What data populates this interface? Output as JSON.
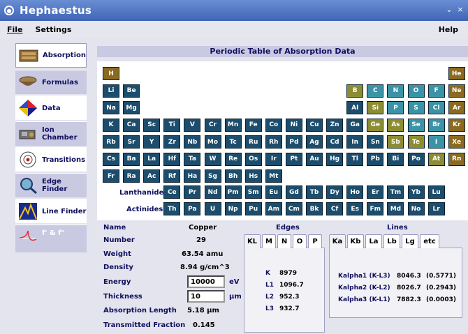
{
  "window": {
    "title": "Hephaestus",
    "controls": [
      "⌄",
      "×"
    ]
  },
  "menu": {
    "file": "File",
    "settings": "Settings",
    "help": "Help"
  },
  "sidebar": {
    "items": [
      {
        "label": "Absorption",
        "icon": "absorption-icon"
      },
      {
        "label": "Formulas",
        "icon": "formulas-icon"
      },
      {
        "label": "Data",
        "icon": "data-icon"
      },
      {
        "label": "Ion Chamber",
        "icon": "ion-chamber-icon"
      },
      {
        "label": "Transitions",
        "icon": "transitions-icon"
      },
      {
        "label": "Edge Finder",
        "icon": "edge-finder-icon"
      },
      {
        "label": "Line Finder",
        "icon": "line-finder-icon"
      },
      {
        "label": "f' & f\"",
        "icon": "anomalous-scattering-icon"
      }
    ],
    "active": 0
  },
  "periodic_table": {
    "title": "Periodic Table of Absorption Data",
    "lanthanides_label": "Lanthanides",
    "actinides_label": "Actinides",
    "colors": {
      "blue": "#1d4d6c",
      "teal": "#3a93a6",
      "olive": "#8c8c32",
      "brown": "#8b6a1f"
    },
    "rows": [
      [
        [
          "H",
          "brown",
          0
        ],
        [
          "He",
          "brown",
          17
        ]
      ],
      [
        [
          "Li",
          "blue",
          0
        ],
        [
          "Be",
          "blue",
          1
        ],
        [
          "B",
          "olive",
          12
        ],
        [
          "C",
          "teal",
          13
        ],
        [
          "N",
          "teal",
          14
        ],
        [
          "O",
          "teal",
          15
        ],
        [
          "F",
          "teal",
          16
        ],
        [
          "Ne",
          "brown",
          17
        ]
      ],
      [
        [
          "Na",
          "blue",
          0
        ],
        [
          "Mg",
          "blue",
          1
        ],
        [
          "Al",
          "blue",
          12
        ],
        [
          "Si",
          "olive",
          13
        ],
        [
          "P",
          "teal",
          14
        ],
        [
          "S",
          "teal",
          15
        ],
        [
          "Cl",
          "teal",
          16
        ],
        [
          "Ar",
          "brown",
          17
        ]
      ],
      [
        [
          "K",
          "blue",
          0
        ],
        [
          "Ca",
          "blue",
          1
        ],
        [
          "Sc",
          "blue",
          2
        ],
        [
          "Ti",
          "blue",
          3
        ],
        [
          "V",
          "blue",
          4
        ],
        [
          "Cr",
          "blue",
          5
        ],
        [
          "Mn",
          "blue",
          6
        ],
        [
          "Fe",
          "blue",
          7
        ],
        [
          "Co",
          "blue",
          8
        ],
        [
          "Ni",
          "blue",
          9
        ],
        [
          "Cu",
          "blue",
          10
        ],
        [
          "Zn",
          "blue",
          11
        ],
        [
          "Ga",
          "blue",
          12
        ],
        [
          "Ge",
          "olive",
          13
        ],
        [
          "As",
          "olive",
          14
        ],
        [
          "Se",
          "teal",
          15
        ],
        [
          "Br",
          "teal",
          16
        ],
        [
          "Kr",
          "brown",
          17
        ]
      ],
      [
        [
          "Rb",
          "blue",
          0
        ],
        [
          "Sr",
          "blue",
          1
        ],
        [
          "Y",
          "blue",
          2
        ],
        [
          "Zr",
          "blue",
          3
        ],
        [
          "Nb",
          "blue",
          4
        ],
        [
          "Mo",
          "blue",
          5
        ],
        [
          "Tc",
          "blue",
          6
        ],
        [
          "Ru",
          "blue",
          7
        ],
        [
          "Rh",
          "blue",
          8
        ],
        [
          "Pd",
          "blue",
          9
        ],
        [
          "Ag",
          "blue",
          10
        ],
        [
          "Cd",
          "blue",
          11
        ],
        [
          "In",
          "blue",
          12
        ],
        [
          "Sn",
          "blue",
          13
        ],
        [
          "Sb",
          "olive",
          14
        ],
        [
          "Te",
          "olive",
          15
        ],
        [
          "I",
          "teal",
          16
        ],
        [
          "Xe",
          "brown",
          17
        ]
      ],
      [
        [
          "Cs",
          "blue",
          0
        ],
        [
          "Ba",
          "blue",
          1
        ],
        [
          "La",
          "blue",
          2
        ],
        [
          "Hf",
          "blue",
          3
        ],
        [
          "Ta",
          "blue",
          4
        ],
        [
          "W",
          "blue",
          5
        ],
        [
          "Re",
          "blue",
          6
        ],
        [
          "Os",
          "blue",
          7
        ],
        [
          "Ir",
          "blue",
          8
        ],
        [
          "Pt",
          "blue",
          9
        ],
        [
          "Au",
          "blue",
          10
        ],
        [
          "Hg",
          "blue",
          11
        ],
        [
          "Tl",
          "blue",
          12
        ],
        [
          "Pb",
          "blue",
          13
        ],
        [
          "Bi",
          "blue",
          14
        ],
        [
          "Po",
          "blue",
          15
        ],
        [
          "At",
          "olive",
          16
        ],
        [
          "Rn",
          "brown",
          17
        ]
      ],
      [
        [
          "Fr",
          "blue",
          0
        ],
        [
          "Ra",
          "blue",
          1
        ],
        [
          "Ac",
          "blue",
          2
        ],
        [
          "Rf",
          "blue",
          3
        ],
        [
          "Ha",
          "blue",
          4
        ],
        [
          "Sg",
          "blue",
          5
        ],
        [
          "Bh",
          "blue",
          6
        ],
        [
          "Hs",
          "blue",
          7
        ],
        [
          "Mt",
          "blue",
          8
        ]
      ]
    ],
    "lanthanides": [
      "Ce",
      "Pr",
      "Nd",
      "Pm",
      "Sm",
      "Eu",
      "Gd",
      "Tb",
      "Dy",
      "Ho",
      "Er",
      "Tm",
      "Yb",
      "Lu"
    ],
    "actinides": [
      "Th",
      "Pa",
      "U",
      "Np",
      "Pu",
      "Am",
      "Cm",
      "Bk",
      "Cf",
      "Es",
      "Fm",
      "Md",
      "No",
      "Lr"
    ]
  },
  "element": {
    "name_label": "Name",
    "name": "Copper",
    "number_label": "Number",
    "number": "29",
    "weight_label": "Weight",
    "weight": "63.54 amu",
    "density_label": "Density",
    "density": "8.94 g/cm^3",
    "energy_label": "Energy",
    "energy": "10000",
    "energy_unit": "eV",
    "thickness_label": "Thickness",
    "thickness": "10",
    "thickness_unit": "µm",
    "absorption_length_label": "Absorption Length",
    "absorption_length": "5.18 µm",
    "transmitted_fraction_label": "Transmitted Fraction",
    "transmitted_fraction": "0.145"
  },
  "edges": {
    "title": "Edges",
    "tabs": [
      "KL",
      "M",
      "N",
      "O",
      "P"
    ],
    "selected": 0,
    "rows": [
      {
        "edge": "K",
        "value": "8979"
      },
      {
        "edge": "L1",
        "value": "1096.7"
      },
      {
        "edge": "L2",
        "value": "952.3"
      },
      {
        "edge": "L3",
        "value": "932.7"
      }
    ]
  },
  "lines": {
    "title": "Lines",
    "tabs": [
      "Ka",
      "Kb",
      "La",
      "Lb",
      "Lg",
      "etc"
    ],
    "selected": 0,
    "rows": [
      {
        "name": "Kalpha1 (K-L3)",
        "energy": "8046.3",
        "intensity": "(0.5771)"
      },
      {
        "name": "Kalpha2 (K-L2)",
        "energy": "8026.7",
        "intensity": "(0.2943)"
      },
      {
        "name": "Kalpha3 (K-L1)",
        "energy": "7882.3",
        "intensity": "(0.0003)"
      }
    ]
  }
}
